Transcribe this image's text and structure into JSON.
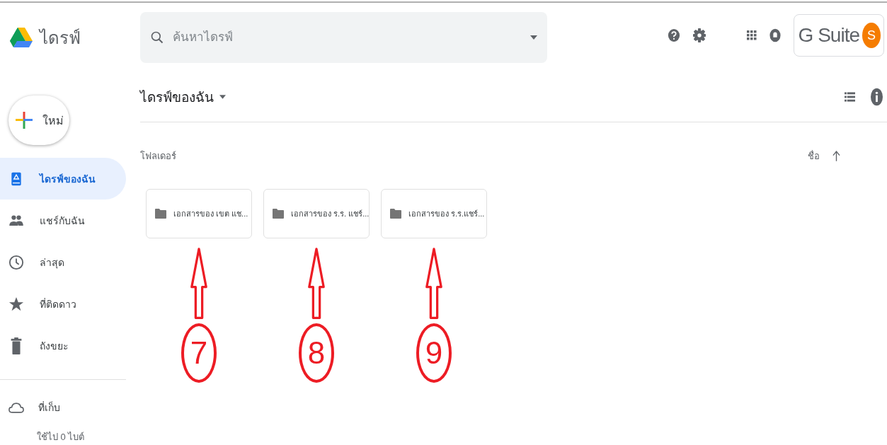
{
  "app": {
    "name": "ไดรฟ์"
  },
  "search": {
    "placeholder": "ค้นหาไดรฟ์"
  },
  "account": {
    "brand": "G Suite",
    "avatar": "S"
  },
  "new_button": {
    "label": "ใหม่"
  },
  "sidebar": {
    "items": [
      {
        "kind": "drive",
        "label": "ไดรฟ์ของฉัน",
        "selected": true
      },
      {
        "kind": "shared",
        "label": "แชร์กับฉัน",
        "selected": false
      },
      {
        "kind": "recent",
        "label": "ล่าสุด",
        "selected": false
      },
      {
        "kind": "starred",
        "label": "ที่ติดดาว",
        "selected": false
      },
      {
        "kind": "trash",
        "label": "ถังขยะ",
        "selected": false
      }
    ]
  },
  "storage": {
    "label": "ที่เก็บ",
    "usage": "ใช้ไป 0 ไบต์"
  },
  "location": "ไดรฟ์ของฉัน",
  "section": "โฟลเดอร์",
  "sort": {
    "label": "ชื่อ"
  },
  "folders": [
    {
      "name": "เอกสารของ เขต แช...",
      "callout": "7"
    },
    {
      "name": "เอกสารของ ร.ร. แชร์...",
      "callout": "8"
    },
    {
      "name": "เอกสารของ ร.ร.แชร์...",
      "callout": "9"
    }
  ]
}
